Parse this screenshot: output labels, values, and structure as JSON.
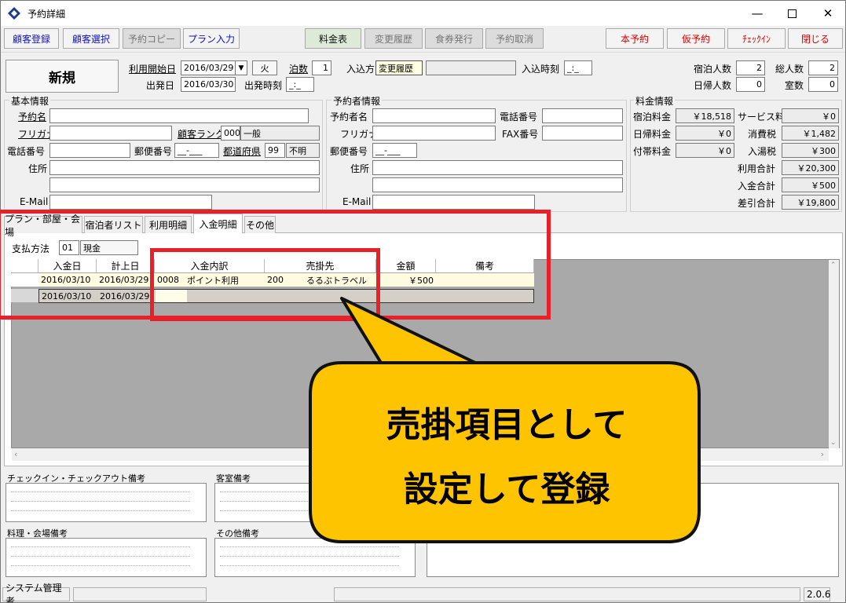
{
  "window": {
    "title": "予約詳細"
  },
  "toolbar": {
    "customer_register": "顧客登録",
    "customer_select": "顧客選択",
    "reservation_copy": "予約コピー",
    "plan_input": "プラン入力",
    "rate_table": "料金表",
    "change_history": "変更履歴",
    "meal_ticket": "食券発行",
    "cancel_reservation": "予約取消",
    "main_reservation": "本予約",
    "tentative_reservation": "仮予約",
    "checkin": "ﾁｪｯｸｲﾝ",
    "close": "閉じる"
  },
  "header": {
    "status": "新規",
    "start_date_label": "利用開始日",
    "start_date": "2016/03/29",
    "weekday": "火",
    "nights_label": "泊数",
    "nights": "1",
    "checkin_label": "入込方",
    "tooltip": "変更履歴",
    "checkin_time_label": "入込時刻",
    "checkin_time": "_:_",
    "depart_label": "出発日",
    "depart_date": "2016/03/30",
    "depart_time_label": "出発時刻",
    "depart_time": "_:_",
    "stay_count_label": "宿泊人数",
    "stay_count": "2",
    "total_count_label": "総人数",
    "total_count": "2",
    "day_count_label": "日帰人数",
    "day_count": "0",
    "rooms_label": "室数",
    "rooms": "0"
  },
  "basic": {
    "title": "基本情報",
    "name_label": "予約名",
    "kana_label": "フリガナ",
    "rank_label": "顧客ランク",
    "rank_code": "000",
    "rank_name": "一般",
    "phone_label": "電話番号",
    "zip_label": "郵便番号",
    "zip": "__-___",
    "pref_label": "都道府県",
    "pref_code": "99",
    "pref_name": "不明",
    "address_label": "住所",
    "email_label": "E-Mail"
  },
  "booker": {
    "title": "予約者情報",
    "name_label": "予約者名",
    "phone_label": "電話番号",
    "kana_label": "フリガナ",
    "fax_label": "FAX番号",
    "zip_label": "郵便番号",
    "zip": "__-___",
    "address_label": "住所",
    "email_label": "E-Mail"
  },
  "fees": {
    "title": "料金情報",
    "stay_fee_label": "宿泊料金",
    "stay_fee": "￥18,518",
    "service_label": "サービス料",
    "service": "￥0",
    "day_fee_label": "日帰料金",
    "day_fee": "￥0",
    "tax_label": "消費税",
    "tax": "￥1,482",
    "extra_fee_label": "付帯料金",
    "extra_fee": "￥0",
    "bath_tax_label": "入湯税",
    "bath_tax": "￥300",
    "use_total_label": "利用合計",
    "use_total": "￥20,300",
    "paid_total_label": "入金合計",
    "paid_total": "￥500",
    "balance_label": "差引合計",
    "balance": "￥19,800"
  },
  "tabs": [
    "プラン・部屋・会場",
    "宿泊者リスト",
    "利用明細",
    "入金明細",
    "その他"
  ],
  "payment": {
    "method_label": "支払方法",
    "method_code": "01",
    "method_name": "現金",
    "columns": [
      "入金日",
      "計上日",
      "入金内訳",
      "売掛先",
      "金額",
      "備考"
    ],
    "rows": [
      {
        "pay_date": "2016/03/10",
        "post_date": "2016/03/29",
        "item_code": "0008",
        "item_name": "ポイント利用",
        "ar_code": "200",
        "ar_name": "るるぶトラベル",
        "amount": "￥500",
        "note": ""
      },
      {
        "pay_date": "2016/03/10",
        "post_date": "2016/03/29",
        "item_code": "",
        "item_name": "",
        "ar_code": "",
        "ar_name": "",
        "amount": "",
        "note": ""
      }
    ]
  },
  "memos": {
    "checkin_note": "チェックイン・チェックアウト備考",
    "room_note": "客室備考",
    "food_note": "料理・会場備考",
    "other_note": "その他備考"
  },
  "callout": {
    "line1": "売掛項目として",
    "line2": "設定して登録"
  },
  "statusbar": {
    "user": "システム管理者",
    "version": "2.0.6"
  },
  "colors": {
    "callout_fill": "#ffc400",
    "highlight_border": "#e8202a"
  }
}
